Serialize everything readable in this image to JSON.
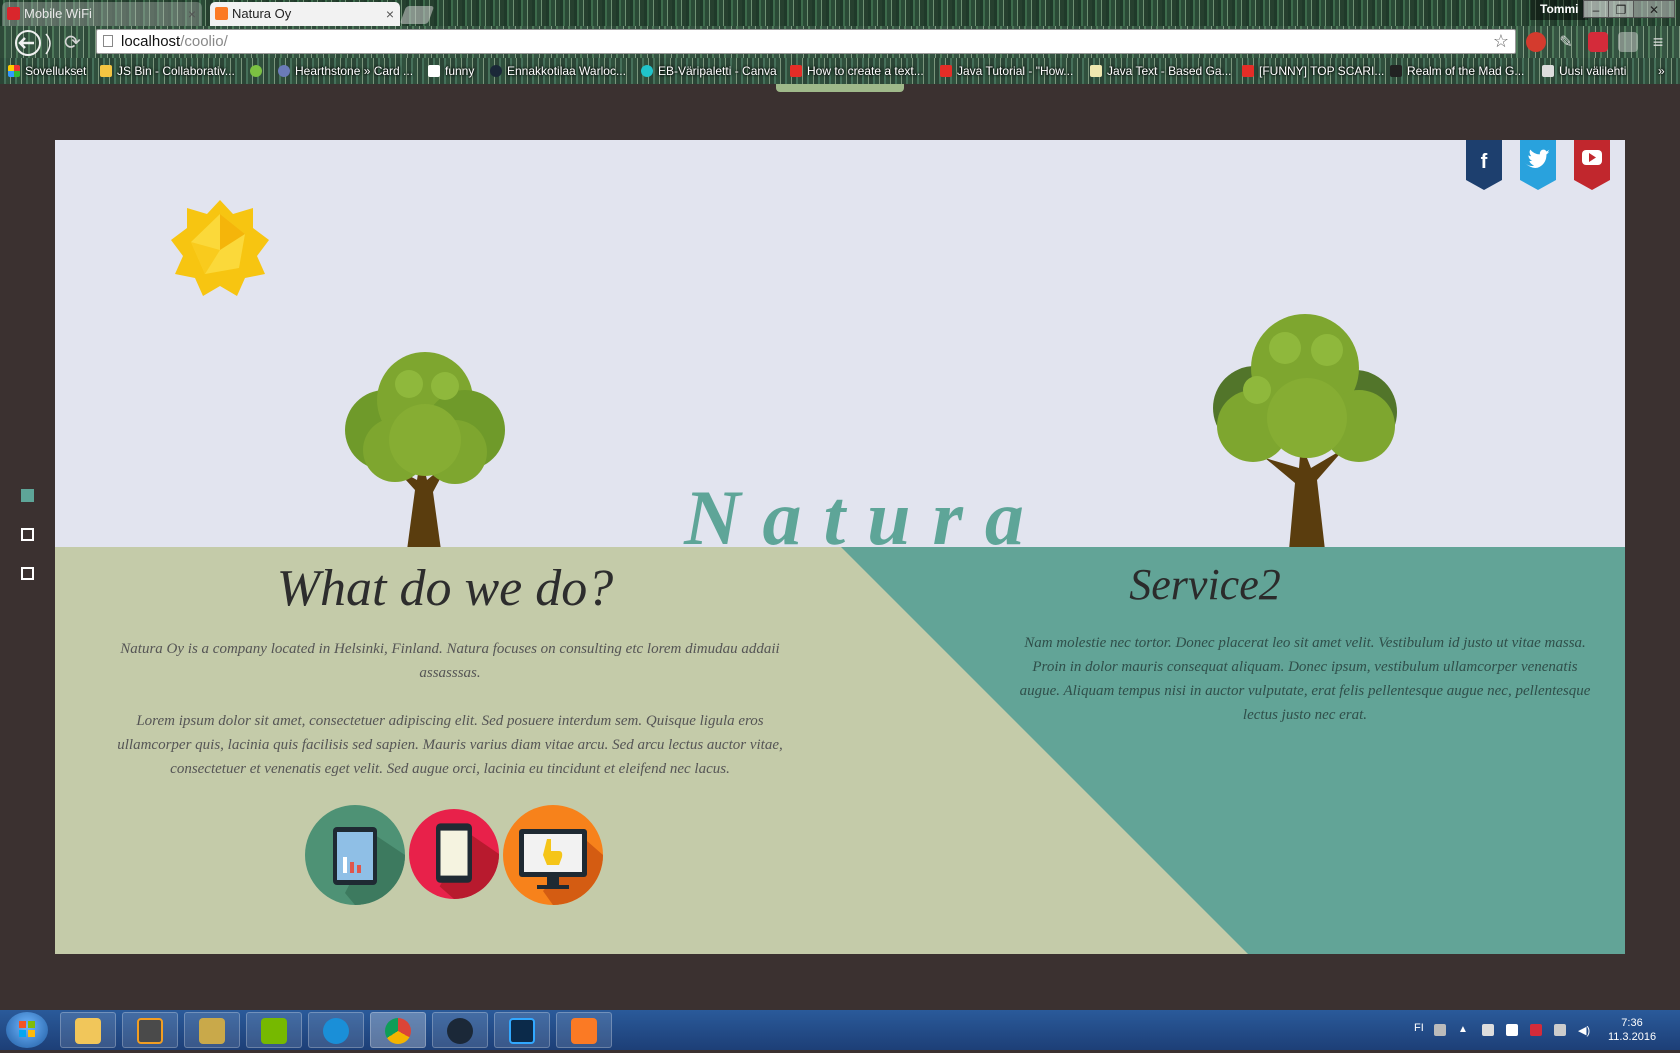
{
  "browser": {
    "tabs": [
      {
        "label": "Mobile WiFi",
        "active": false
      },
      {
        "label": "Natura Oy",
        "active": true
      }
    ],
    "user": "Tommi",
    "url_host": "localhost",
    "url_path": "/coolio/",
    "bookmarks": [
      "Sovellukset",
      "JS Bin - Collaborativ...",
      "Hearthstone » Card ...",
      "funny",
      "Ennakkotilaa Warloc...",
      "EB-Väripaletti - Canva",
      "How to create a text...",
      "Java Tutorial - \"How...",
      "Java Text - Based Ga...",
      "[FUNNY] TOP SCARI...",
      "Realm of the Mad G...",
      "Uusi välilehti"
    ]
  },
  "page": {
    "brand": "Natura",
    "social": [
      "facebook-icon",
      "twitter-icon",
      "youtube-icon"
    ],
    "section1": {
      "title": "What do we do?",
      "para1": "Natura Oy is a company located in Helsinki, Finland. Natura focuses on consulting etc lorem dimudau addaii assasssas.",
      "para2": "Lorem ipsum dolor sit amet, consectetuer adipiscing elit. Sed posuere interdum sem. Quisque ligula eros ullamcorper quis, lacinia quis facilisis sed sapien. Mauris varius diam vitae arcu. Sed arcu lectus auctor vitae, consectetuer et venenatis eget velit. Sed augue orci, lacinia eu tincidunt et eleifend nec lacus."
    },
    "section2": {
      "title": "Service2",
      "para": "Nam molestie nec tortor. Donec placerat leo sit amet velit. Vestibulum id justo ut vitae massa. Proin in dolor mauris consequat aliquam. Donec ipsum, vestibulum ullamcorper venenatis augue. Aliquam tempus nisi in auctor vulputate, erat felis pellentesque augue nec, pellentesque lectus justo nec erat."
    },
    "colors": {
      "background": "#3b3130",
      "hero": "#e2e4ef",
      "section1": "#c4cba9",
      "section2": "#62a497",
      "brand": "#5ea598"
    }
  },
  "taskbar": {
    "language": "FI",
    "time": "7:36",
    "date": "11.3.2016",
    "apps": [
      "folder-icon",
      "sublime-icon",
      "league-icon",
      "nvidia-icon",
      "battlenet-icon",
      "chrome-icon",
      "steam-icon",
      "photoshop-icon",
      "xampp-icon"
    ]
  }
}
